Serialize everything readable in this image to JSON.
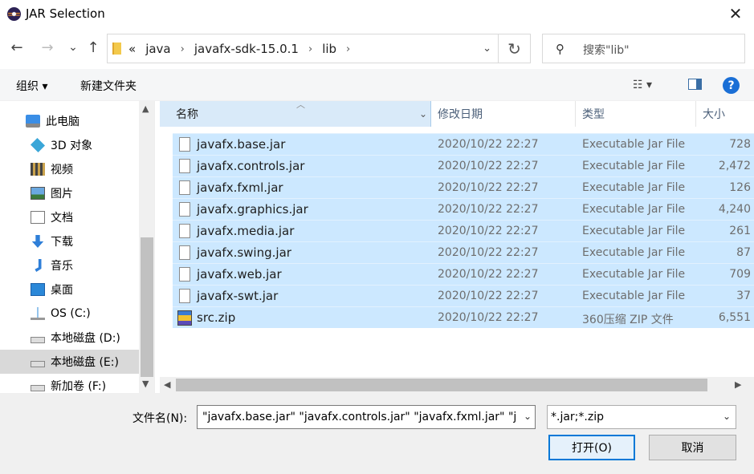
{
  "window": {
    "title": "JAR Selection",
    "close_label": "✕"
  },
  "nav": {
    "back": "←",
    "forward": "→",
    "recent": "⌄",
    "up": "↑",
    "breadcrumb": [
      "«",
      "java",
      "javafx-sdk-15.0.1",
      "lib"
    ],
    "refresh": "↻",
    "search_placeholder": "搜索\"lib\""
  },
  "toolbar": {
    "organize_label": "组织 ▾",
    "new_folder_label": "新建文件夹",
    "view_label": "☷ ▾",
    "help_label": "?"
  },
  "sidebar": {
    "items": [
      {
        "label": "此电脑",
        "icon": "computer-icon"
      },
      {
        "label": "3D 对象",
        "icon": "cube-icon"
      },
      {
        "label": "视频",
        "icon": "film-icon"
      },
      {
        "label": "图片",
        "icon": "picture-icon"
      },
      {
        "label": "文档",
        "icon": "document-icon"
      },
      {
        "label": "下载",
        "icon": "download-icon"
      },
      {
        "label": "音乐",
        "icon": "music-icon"
      },
      {
        "label": "桌面",
        "icon": "desktop-icon"
      },
      {
        "label": "OS (C:)",
        "icon": "windows-drive-icon"
      },
      {
        "label": "本地磁盘 (D:)",
        "icon": "drive-icon"
      },
      {
        "label": "本地磁盘 (E:)",
        "icon": "drive-icon",
        "selected": true
      },
      {
        "label": "新加卷 (F:)",
        "icon": "drive-icon"
      }
    ]
  },
  "columns": {
    "name": "名称",
    "date": "修改日期",
    "type": "类型",
    "size": "大小"
  },
  "files": [
    {
      "name": "javafx.base.jar",
      "date": "2020/10/22 22:27",
      "type": "Executable Jar File",
      "size": "728"
    },
    {
      "name": "javafx.controls.jar",
      "date": "2020/10/22 22:27",
      "type": "Executable Jar File",
      "size": "2,472"
    },
    {
      "name": "javafx.fxml.jar",
      "date": "2020/10/22 22:27",
      "type": "Executable Jar File",
      "size": "126"
    },
    {
      "name": "javafx.graphics.jar",
      "date": "2020/10/22 22:27",
      "type": "Executable Jar File",
      "size": "4,240"
    },
    {
      "name": "javafx.media.jar",
      "date": "2020/10/22 22:27",
      "type": "Executable Jar File",
      "size": "261"
    },
    {
      "name": "javafx.swing.jar",
      "date": "2020/10/22 22:27",
      "type": "Executable Jar File",
      "size": "87"
    },
    {
      "name": "javafx.web.jar",
      "date": "2020/10/22 22:27",
      "type": "Executable Jar File",
      "size": "709"
    },
    {
      "name": "javafx-swt.jar",
      "date": "2020/10/22 22:27",
      "type": "Executable Jar File",
      "size": "37"
    },
    {
      "name": "src.zip",
      "date": "2020/10/22 22:27",
      "type": "360压缩 ZIP 文件",
      "size": "6,551",
      "zip": true
    }
  ],
  "footer": {
    "filename_label": "文件名(N):",
    "filename_value": "\"javafx.base.jar\" \"javafx.controls.jar\" \"javafx.fxml.jar\" \"ja",
    "filetype_value": "*.jar;*.zip",
    "open_label": "打开(O)",
    "cancel_label": "取消"
  },
  "colors": {
    "selection": "#cce8ff",
    "accent": "#0078d7"
  }
}
